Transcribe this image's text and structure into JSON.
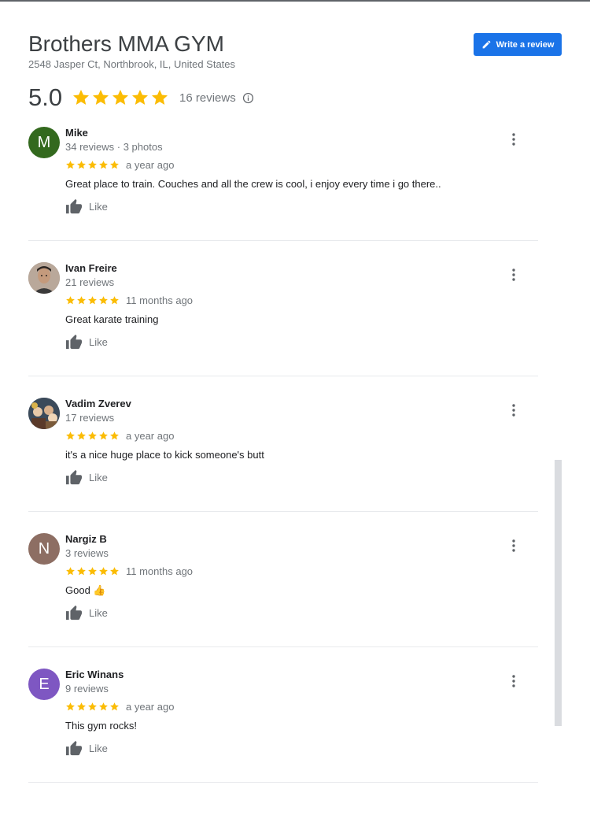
{
  "business": {
    "name": "Brothers MMA GYM",
    "address": "2548 Jasper Ct, Northbrook, IL, United States",
    "rating": "5.0",
    "review_count": "16 reviews",
    "write_review_label": "Write a review"
  },
  "colors": {
    "accent": "#1a73e8",
    "star": "#fbbc04"
  },
  "reviews": [
    {
      "name": "Mike",
      "meta": "34 reviews · 3 photos",
      "stars": 5,
      "date": "a year ago",
      "text": "Great place to train. Couches and all the crew is cool, i enjoy every time i go there..",
      "like_label": "Like",
      "avatar_letter": "M",
      "avatar_color": "#33691e"
    },
    {
      "name": "Ivan Freire",
      "meta": "21 reviews",
      "stars": 5,
      "date": "11 months ago",
      "text": "Great karate training",
      "like_label": "Like",
      "avatar_letter": "",
      "avatar_color": "#8a7a70"
    },
    {
      "name": "Vadim Zverev",
      "meta": "17 reviews",
      "stars": 5,
      "date": "a year ago",
      "text": "it's a nice huge place to kick someone's butt",
      "like_label": "Like",
      "avatar_letter": "",
      "avatar_color": "#3b4a5a"
    },
    {
      "name": "Nargiz B",
      "meta": "3 reviews",
      "stars": 5,
      "date": "11 months ago",
      "text": "Good 👍",
      "like_label": "Like",
      "avatar_letter": "N",
      "avatar_color": "#8d6e63"
    },
    {
      "name": "Eric Winans",
      "meta": "9 reviews",
      "stars": 5,
      "date": "a year ago",
      "text": "This gym rocks!",
      "like_label": "Like",
      "avatar_letter": "E",
      "avatar_color": "#7e57c2"
    }
  ]
}
